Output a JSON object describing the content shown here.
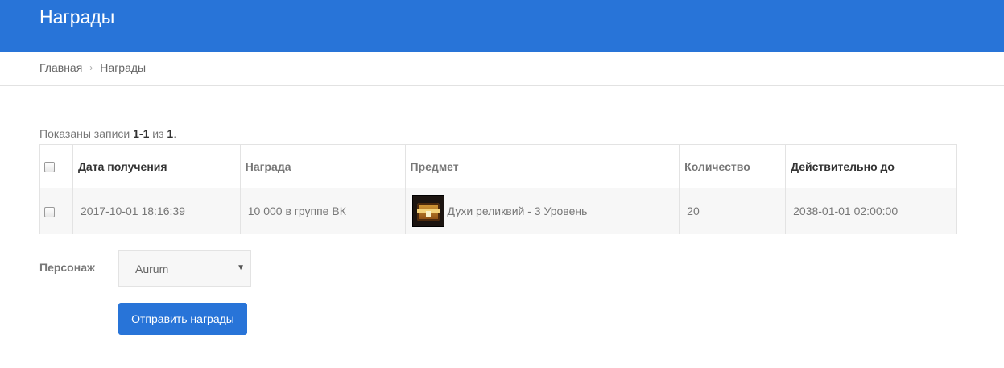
{
  "header": {
    "title": "Награды",
    "color": "#2874d8"
  },
  "breadcrumb": {
    "home": "Главная",
    "separator": "›",
    "current": "Награды"
  },
  "summary": {
    "prefix": "Показаны записи ",
    "range": "1-1",
    "middle": " из ",
    "total": "1",
    "suffix": "."
  },
  "table": {
    "columns": [
      "Дата получения",
      "Награда",
      "Предмет",
      "Количество",
      "Действительно до"
    ],
    "rows": [
      {
        "date": "2017-10-01 18:16:39",
        "reward": "10 000 в группе ВК",
        "item_icon": "treasure-chest-icon",
        "item": "Духи реликвий - 3 Уровень",
        "quantity": "20",
        "valid_until": "2038-01-01 02:00:00"
      }
    ]
  },
  "form": {
    "character_label": "Персонаж",
    "character_value": "Aurum",
    "submit_label": "Отправить награды"
  }
}
